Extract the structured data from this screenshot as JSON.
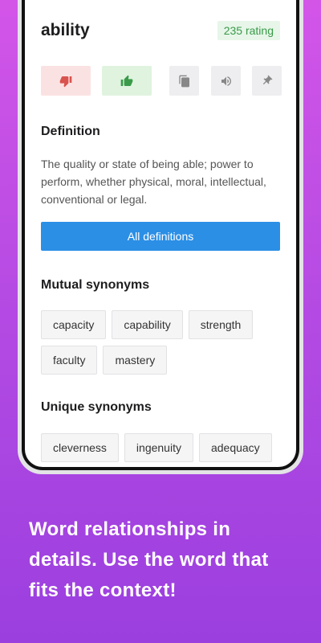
{
  "word": {
    "title": "ability",
    "rating": "235 rating"
  },
  "actions": {
    "dislike": "thumbs-down-icon",
    "like": "thumbs-up-icon",
    "copy": "copy-icon",
    "sound": "speaker-icon",
    "pin": "pin-icon"
  },
  "colors": {
    "dislike_bg": "#fbe2e2",
    "dislike_fg": "#d9534f",
    "like_bg": "#dff3df",
    "like_fg": "#3a9a4a",
    "primary": "#2b8fe6",
    "rating_fg": "#3a9a4a"
  },
  "definition": {
    "heading": "Definition",
    "text": "The quality or state of being able; power to perform, whether physical, moral, intellectual, conventional or legal.",
    "button_label": "All definitions"
  },
  "mutual": {
    "heading": "Mutual synonyms",
    "chips": [
      "capacity",
      "capability",
      "strength",
      "faculty",
      "mastery"
    ]
  },
  "unique": {
    "heading": "Unique synonyms",
    "chips": [
      "cleverness",
      "ingenuity",
      "adequacy",
      "",
      ""
    ]
  },
  "caption": {
    "text": "Word relationships in details. Use the word that fits the context!"
  }
}
